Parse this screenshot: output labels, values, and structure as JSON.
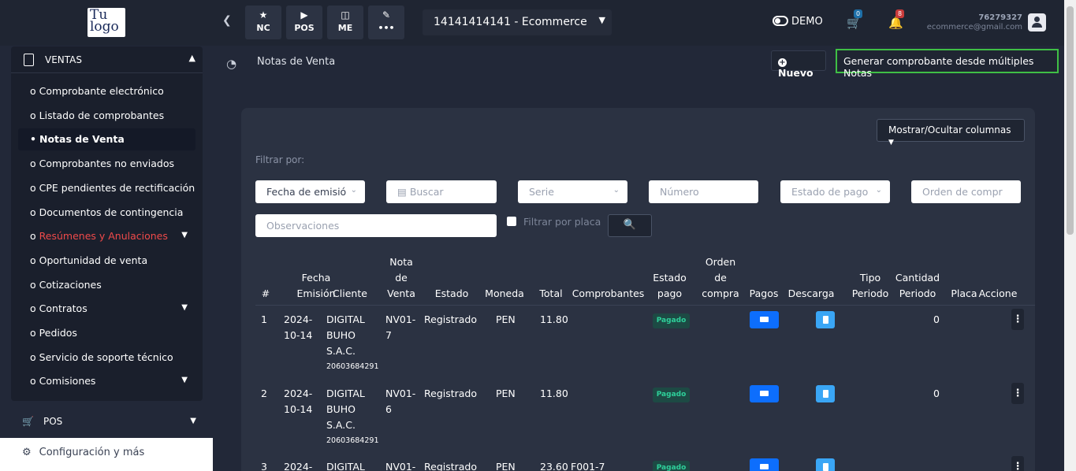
{
  "logo": {
    "line1": "Tu",
    "line2": "logo"
  },
  "topbar": {
    "quick_buttons": [
      {
        "icon": "star-icon",
        "glyph": "★",
        "label": "NC"
      },
      {
        "icon": "play-icon",
        "glyph": "▶",
        "label": "POS"
      },
      {
        "icon": "boxes-icon",
        "glyph": "◫",
        "label": "ME"
      },
      {
        "icon": "pencil-icon",
        "glyph": "✎",
        "label": "•••"
      }
    ],
    "branch": "14141414141 - Ecommerce",
    "demo_label": "DEMO",
    "cart_badge": "0",
    "bell_badge": "8",
    "user_id": "76279327",
    "user_email": "ecommerce@gmail.com"
  },
  "sidebar": {
    "section": "VENTAS",
    "items": [
      {
        "label": "Comprobante electrónico",
        "bullet": "o",
        "style": ""
      },
      {
        "label": "Listado de comprobantes",
        "bullet": "o",
        "style": ""
      },
      {
        "label": "Notas de Venta",
        "bullet": "•",
        "style": "active"
      },
      {
        "label": "Comprobantes no enviados",
        "bullet": "o",
        "style": ""
      },
      {
        "label": "CPE pendientes de rectificación",
        "bullet": "o",
        "style": ""
      },
      {
        "label": "Documentos de contingencia",
        "bullet": "o",
        "style": ""
      },
      {
        "label": "Resúmenes y Anulaciones",
        "bullet": "o",
        "style": "red",
        "expand": true
      },
      {
        "label": "Oportunidad de venta",
        "bullet": "o",
        "style": ""
      },
      {
        "label": "Cotizaciones",
        "bullet": "o",
        "style": ""
      },
      {
        "label": "Contratos",
        "bullet": "o",
        "style": "",
        "expand": true
      },
      {
        "label": "Pedidos",
        "bullet": "o",
        "style": ""
      },
      {
        "label": "Servicio de soporte técnico",
        "bullet": "o",
        "style": ""
      },
      {
        "label": "Comisiones",
        "bullet": "o",
        "style": "",
        "expand": true
      }
    ],
    "pos_label": "POS",
    "config_label": "Configuración y más"
  },
  "main": {
    "title": "Notas de Venta",
    "new_button": "Nuevo",
    "multi_button": "Generar comprobante desde múltiples Notas",
    "columns_button": "Mostrar/Ocultar columnas",
    "filter_label": "Filtrar por:",
    "filters": {
      "date_select": "Fecha de emisió",
      "search_placeholder": "Buscar",
      "serie_placeholder": "Serie",
      "number_placeholder": "Número",
      "payment_state_placeholder": "Estado de pago",
      "order_placeholder": "Orden de compr",
      "observations_placeholder": "Observaciones",
      "plate_checkbox_label": "Filtrar por placa"
    }
  },
  "table": {
    "headers": [
      "#",
      "Fecha\nEmisión",
      "Cliente",
      "Nota\nde\nVenta",
      "Estado",
      "Moneda",
      "Total",
      "Comprobantes",
      "Estado\npago",
      "Orden\nde\ncompra",
      "Pagos",
      "Descarga",
      "Tipo\nPeriodo",
      "Cantidad\nPeriodo",
      "Placa",
      "Accione"
    ],
    "rows": [
      {
        "n": "1",
        "date": "2024-\n10-14",
        "client": "DIGITAL\nBUHO\nS.A.C.",
        "ruc": "20603684291",
        "note": "NV01-\n7",
        "state": "Registrado",
        "currency": "PEN",
        "total": "11.80",
        "vouchers": "",
        "pay_state": "Pagado",
        "qty": "0"
      },
      {
        "n": "2",
        "date": "2024-\n10-14",
        "client": "DIGITAL\nBUHO\nS.A.C.",
        "ruc": "20603684291",
        "note": "NV01-\n6",
        "state": "Registrado",
        "currency": "PEN",
        "total": "11.80",
        "vouchers": "",
        "pay_state": "Pagado",
        "qty": "0"
      },
      {
        "n": "3",
        "date": "2024-",
        "client": "DIGITAL",
        "ruc": "",
        "note": "NV01-",
        "state": "Registrado",
        "currency": "PEN",
        "total": "23.60",
        "vouchers": "F001-7",
        "pay_state": "Pagado",
        "qty": ""
      }
    ]
  },
  "colors": {
    "accent_green": "#3fbf45",
    "paid": "#2ed09a",
    "blue": "#0d6efd",
    "red_item": "#ef4a4a"
  }
}
